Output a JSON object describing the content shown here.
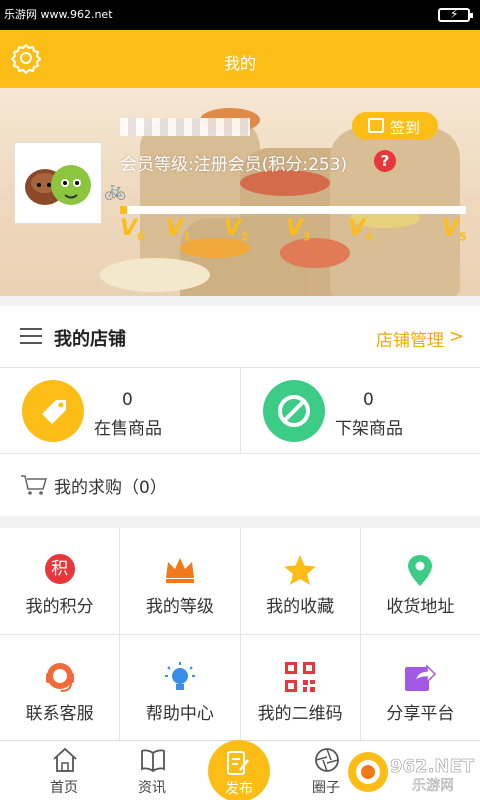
{
  "status_bar": {
    "watermark": "乐游网 www.962.net"
  },
  "header": {
    "title": "我的"
  },
  "profile": {
    "level_text": "会员等级:注册会员(积分:253)",
    "help_glyph": "?",
    "signin_label": "签到",
    "progress": 0.02,
    "levels": [
      "V0",
      "V1",
      "V2",
      "V3",
      "V4",
      "V5"
    ]
  },
  "shop": {
    "title": "我的店铺",
    "manage_label": "店铺管理",
    "on_sale": {
      "count": "0",
      "label": "在售商品",
      "color": "#fcbd17"
    },
    "off_shelf": {
      "count": "0",
      "label": "下架商品",
      "color": "#3dcc86"
    },
    "purchase_label": "我的求购（0）"
  },
  "grid": [
    {
      "label": "我的积分",
      "icon": "points-icon"
    },
    {
      "label": "我的等级",
      "icon": "crown-icon"
    },
    {
      "label": "我的收藏",
      "icon": "star-icon"
    },
    {
      "label": "收货地址",
      "icon": "location-pin-icon"
    },
    {
      "label": "联系客服",
      "icon": "headset-icon"
    },
    {
      "label": "帮助中心",
      "icon": "lightbulb-icon"
    },
    {
      "label": "我的二维码",
      "icon": "qr-code-icon"
    },
    {
      "label": "分享平台",
      "icon": "share-icon"
    }
  ],
  "points_glyph": "积",
  "tabs": {
    "home": "首页",
    "news": "资讯",
    "publish": "发布",
    "circle": "圈子"
  },
  "watermark": "962.NET 乐游网",
  "colors": {
    "accent": "#fcbd17",
    "red": "#e8373a",
    "green": "#3dcc86"
  }
}
